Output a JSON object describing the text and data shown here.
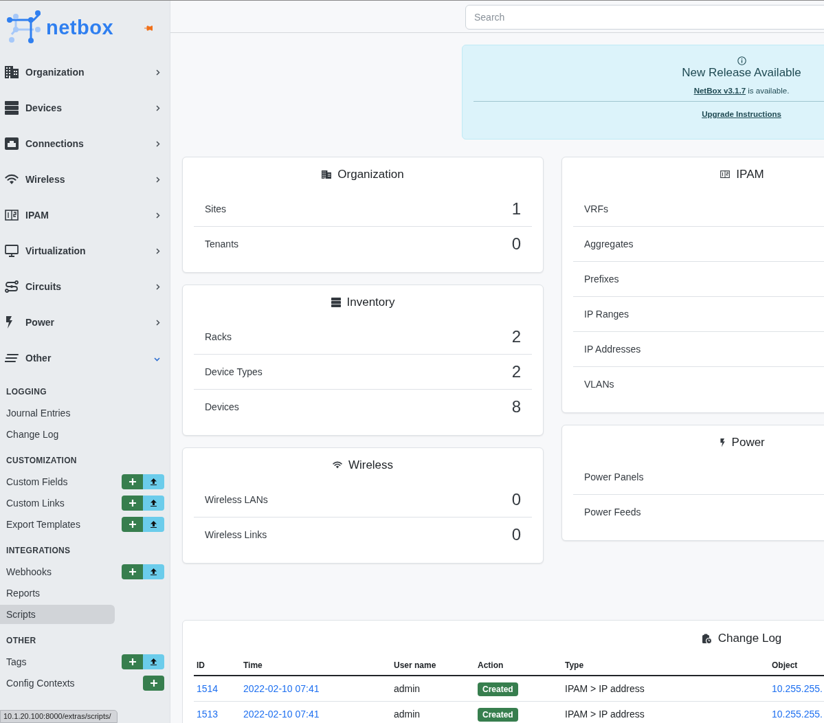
{
  "sidebar": {
    "brand": "netbox",
    "menu": [
      {
        "label": "Organization",
        "expanded": false
      },
      {
        "label": "Devices",
        "expanded": false
      },
      {
        "label": "Connections",
        "expanded": false
      },
      {
        "label": "Wireless",
        "expanded": false
      },
      {
        "label": "IPAM",
        "expanded": false
      },
      {
        "label": "Virtualization",
        "expanded": false
      },
      {
        "label": "Circuits",
        "expanded": false
      },
      {
        "label": "Power",
        "expanded": false
      },
      {
        "label": "Other",
        "expanded": true
      }
    ],
    "sections": [
      {
        "heading": "LOGGING",
        "items": [
          {
            "label": "Journal Entries",
            "selected": false,
            "add": false,
            "import": false
          },
          {
            "label": "Change Log",
            "selected": false,
            "add": false,
            "import": false
          }
        ]
      },
      {
        "heading": "CUSTOMIZATION",
        "items": [
          {
            "label": "Custom Fields",
            "selected": false,
            "add": true,
            "import": true
          },
          {
            "label": "Custom Links",
            "selected": false,
            "add": true,
            "import": true
          },
          {
            "label": "Export Templates",
            "selected": false,
            "add": true,
            "import": true
          }
        ]
      },
      {
        "heading": "INTEGRATIONS",
        "items": [
          {
            "label": "Webhooks",
            "selected": false,
            "add": true,
            "import": true
          },
          {
            "label": "Reports",
            "selected": false,
            "add": false,
            "import": false
          },
          {
            "label": "Scripts",
            "selected": true,
            "add": false,
            "import": false
          }
        ]
      },
      {
        "heading": "OTHER",
        "items": [
          {
            "label": "Tags",
            "selected": false,
            "add": true,
            "import": true
          },
          {
            "label": "Config Contexts",
            "selected": false,
            "add": true,
            "import": false
          }
        ]
      }
    ]
  },
  "search": {
    "placeholder": "Search"
  },
  "alert": {
    "title": "New Release Available",
    "link": "NetBox v3.1.7",
    "message": "is available.",
    "action": "Upgrade Instructions"
  },
  "left_cards": [
    {
      "title": "Organization",
      "rows": [
        {
          "label": "Sites",
          "count": "1"
        },
        {
          "label": "Tenants",
          "count": "0"
        }
      ]
    },
    {
      "title": "Inventory",
      "rows": [
        {
          "label": "Racks",
          "count": "2"
        },
        {
          "label": "Device Types",
          "count": "2"
        },
        {
          "label": "Devices",
          "count": "8"
        }
      ]
    },
    {
      "title": "Wireless",
      "rows": [
        {
          "label": "Wireless LANs",
          "count": "0"
        },
        {
          "label": "Wireless Links",
          "count": "0"
        }
      ]
    }
  ],
  "right_cards": [
    {
      "title": "IPAM",
      "rows": [
        {
          "label": "VRFs"
        },
        {
          "label": "Aggregates"
        },
        {
          "label": "Prefixes"
        },
        {
          "label": "IP Ranges"
        },
        {
          "label": "IP Addresses"
        },
        {
          "label": "VLANs"
        }
      ]
    },
    {
      "title": "Power",
      "rows": [
        {
          "label": "Power Panels"
        },
        {
          "label": "Power Feeds"
        }
      ]
    }
  ],
  "changelog": {
    "title": "Change Log",
    "columns": [
      "ID",
      "Time",
      "User name",
      "Action",
      "Type",
      "Object"
    ],
    "rows": [
      {
        "id": "1514",
        "time": "2022-02-10 07:41",
        "user": "admin",
        "action": "Created",
        "type": "IPAM > IP address",
        "object": "10.255.255."
      },
      {
        "id": "1513",
        "time": "2022-02-10 07:41",
        "user": "admin",
        "action": "Created",
        "type": "IPAM > IP address",
        "object": "10.255.255."
      }
    ]
  },
  "status_url": "10.1.20.100:8000/extras/scripts/"
}
